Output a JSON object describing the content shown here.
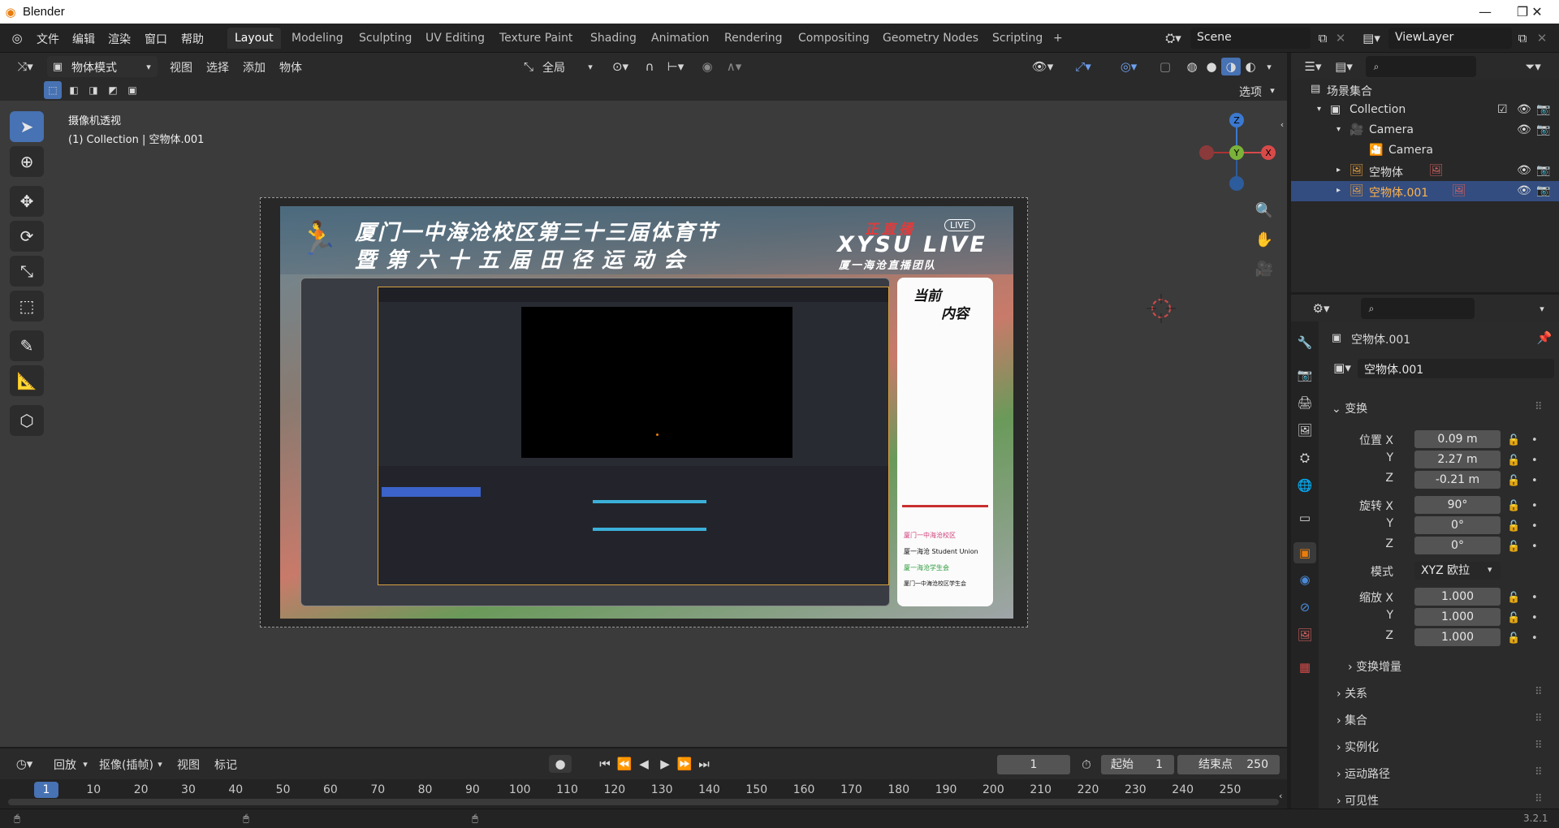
{
  "window": {
    "title": "Blender",
    "minimize": "—",
    "maximize": "❐",
    "close": "✕"
  },
  "menu": [
    "文件",
    "编辑",
    "渲染",
    "窗口",
    "帮助"
  ],
  "workspaces": [
    "Layout",
    "Modeling",
    "Sculpting",
    "UV Editing",
    "Texture Paint",
    "Shading",
    "Animation",
    "Rendering",
    "Compositing",
    "Geometry Nodes",
    "Scripting",
    "+"
  ],
  "active_workspace": "Layout",
  "scene": {
    "name": "Scene",
    "view_layer": "ViewLayer"
  },
  "viewport_header": {
    "mode": "物体模式",
    "menus": [
      "视图",
      "选择",
      "添加",
      "物体"
    ],
    "transform_orientation": "全局",
    "options": "选项"
  },
  "viewport_overlay_text": {
    "view_name": "摄像机透视",
    "collection_info": "(1) Collection | 空物体.001"
  },
  "camera_view": {
    "title_line1": "厦门一中海沧校区第三十三届体育节",
    "title_line2": "暨第六十五届田径运动会",
    "live_label": "正直播",
    "live_badge": "LIVE",
    "brand": "XYSU LIVE",
    "brand_sub": "厦一海沧直播团队",
    "side_title_1": "当前",
    "side_title_2": "内容",
    "side_links": [
      "厦门一中海沧校区",
      "厦一海沧 Student Union",
      "厦一海沧学生会",
      "厦门一中海沧校区学生会"
    ]
  },
  "outliner": {
    "header": "场景集合",
    "rows": [
      {
        "label": "Collection",
        "level": 1,
        "selected": false
      },
      {
        "label": "Camera",
        "level": 2,
        "selected": false
      },
      {
        "label": "Camera",
        "level": 3,
        "selected": false
      },
      {
        "label": "空物体",
        "level": 2,
        "selected": false
      },
      {
        "label": "空物体.001",
        "level": 2,
        "selected": true
      }
    ]
  },
  "properties": {
    "object_name": "空物体.001",
    "object_field": "空物体.001",
    "section_transform": "变换",
    "location_label": "位置 X",
    "location": [
      "0.09 m",
      "2.27 m",
      "-0.21 m"
    ],
    "rotation_label": "旋转 X",
    "rotation": [
      "90°",
      "0°",
      "0°"
    ],
    "mode_label": "模式",
    "rotation_mode": "XYZ 欧拉",
    "scale_label": "缩放 X",
    "scale": [
      "1.000",
      "1.000",
      "1.000"
    ],
    "axis_y": "Y",
    "axis_z": "Z",
    "delta_transform": "变换增量",
    "sections": [
      "关系",
      "集合",
      "实例化",
      "运动路径",
      "可见性"
    ]
  },
  "timeline": {
    "menus": [
      "回放",
      "抠像(插帧)",
      "视图",
      "标记"
    ],
    "current_frame": "1",
    "start_label": "起始",
    "start": "1",
    "end_label": "结束点",
    "end": "250",
    "ticks": [
      "1",
      "10",
      "20",
      "30",
      "40",
      "50",
      "60",
      "70",
      "80",
      "90",
      "100",
      "110",
      "120",
      "130",
      "140",
      "150",
      "160",
      "170",
      "180",
      "190",
      "200",
      "210",
      "220",
      "230",
      "240",
      "250"
    ]
  },
  "version": "3.2.1",
  "colors": {
    "accent": "#4772b3",
    "selected_row": "#334d80",
    "orange": "#e87d0d"
  }
}
